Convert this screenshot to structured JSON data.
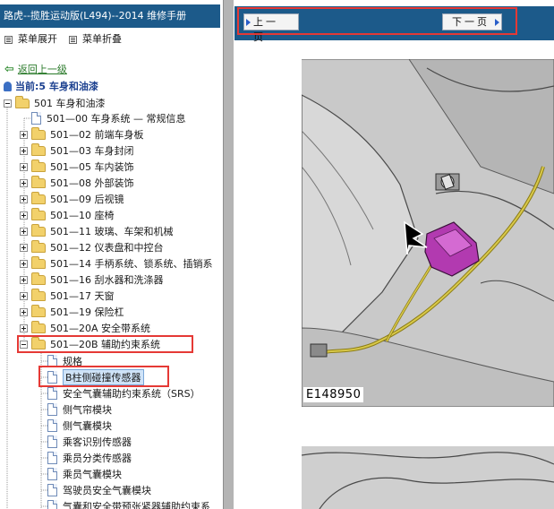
{
  "window": {
    "title": "路虎--揽胜运动版(L494)--2014 维修手册"
  },
  "menu": {
    "expand_label": "菜单展开",
    "collapse_label": "菜单折叠"
  },
  "navigation": {
    "back_label": "返回上一级",
    "current_label": "当前:5 车身和油漆"
  },
  "tree": {
    "root_label": "501 车身和油漆",
    "items": [
      {
        "label": "501—00 车身系统 — 常规信息",
        "kind": "doc"
      },
      {
        "label": "501—02 前端车身板",
        "kind": "folder"
      },
      {
        "label": "501—03 车身封闭",
        "kind": "folder"
      },
      {
        "label": "501—05 车内装饰",
        "kind": "folder"
      },
      {
        "label": "501—08 外部装饰",
        "kind": "folder"
      },
      {
        "label": "501—09 后视镜",
        "kind": "folder"
      },
      {
        "label": "501—10 座椅",
        "kind": "folder"
      },
      {
        "label": "501—11 玻璃、车架和机械",
        "kind": "folder"
      },
      {
        "label": "501—12 仪表盘和中控台",
        "kind": "folder"
      },
      {
        "label": "501—14 手柄系统、锁系统、插销系",
        "kind": "folder"
      },
      {
        "label": "501—16 刮水器和洗涤器",
        "kind": "folder"
      },
      {
        "label": "501—17 天窗",
        "kind": "folder"
      },
      {
        "label": "501—19 保险杠",
        "kind": "folder"
      },
      {
        "label": "501—20A 安全带系统",
        "kind": "folder"
      },
      {
        "label": "501—20B 辅助约束系统",
        "kind": "folder-open"
      }
    ],
    "sub_items": [
      {
        "label": "规格"
      },
      {
        "label": "B柱侧碰撞传感器"
      },
      {
        "label": "安全气囊辅助约束系统（SRS）"
      },
      {
        "label": "侧气帘模块"
      },
      {
        "label": "侧气囊模块"
      },
      {
        "label": "乘客识别传感器"
      },
      {
        "label": "乘员分类传感器"
      },
      {
        "label": "乘员气囊模块"
      },
      {
        "label": "驾驶员安全气囊模块"
      },
      {
        "label": "气囊和安全带预张紧器辅助约束系"
      }
    ]
  },
  "pager": {
    "prev_label": "上一页",
    "next_label": "下一页"
  },
  "figure": {
    "caption": "E148950"
  },
  "colors": {
    "header_blue": "#1c5a8a",
    "highlight_red": "#e53935",
    "connector_purple": "#b23ab0",
    "wire_yellow": "#c9b93a"
  }
}
